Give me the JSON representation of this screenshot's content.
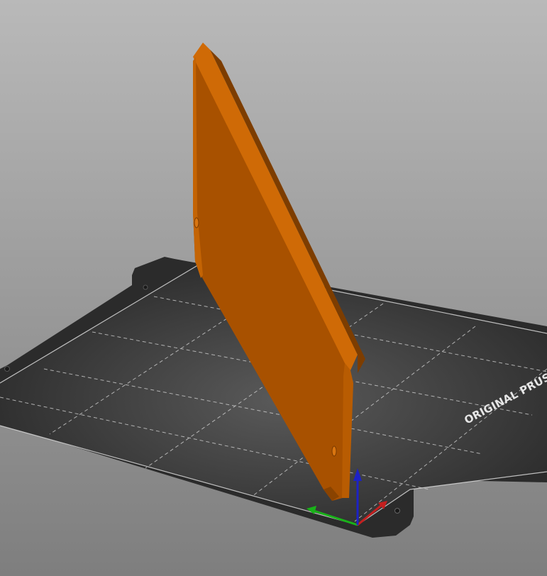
{
  "viewport": {
    "background_top": "#b9b9b9",
    "background_bottom": "#7e7e7e"
  },
  "bed": {
    "label": "ORIGINAL PRUSA MI",
    "sheet_color": "#2b2b2b",
    "surface_color": "#3a3a3a",
    "grid_color": "#d8d8d8",
    "label_color": "#e6e6e6"
  },
  "model": {
    "color_front": "#a85100",
    "color_top": "#cf6a06",
    "color_side": "#8a4300"
  },
  "axes": {
    "x_color": "#c41f1f",
    "y_color": "#19b219",
    "z_color": "#1c22c6",
    "x_icon": "x-axis-arrow-icon",
    "y_icon": "y-axis-arrow-icon",
    "z_icon": "z-axis-arrow-icon"
  }
}
